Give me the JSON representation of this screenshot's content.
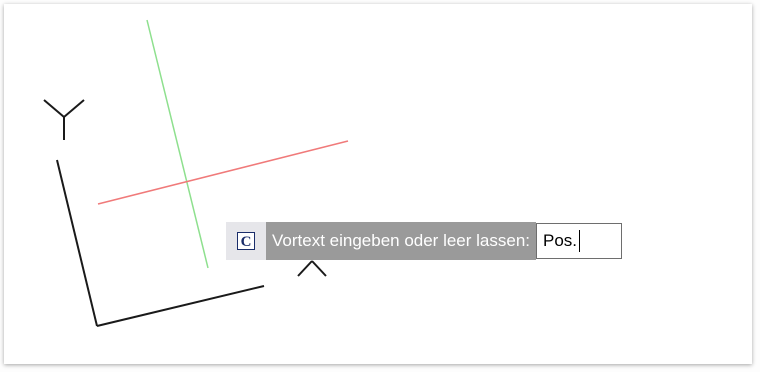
{
  "viewport": {
    "ucs_y_label": "Y"
  },
  "dynamic_input": {
    "icon_letter": "C",
    "prompt": "Vortext eingeben oder leer lassen:",
    "value": "Pos."
  },
  "colors": {
    "x_axis": "#f07a7a",
    "y_axis": "#8ee08e",
    "label_bg": "#9a9a9a",
    "icon_border": "#1a2d6a"
  }
}
